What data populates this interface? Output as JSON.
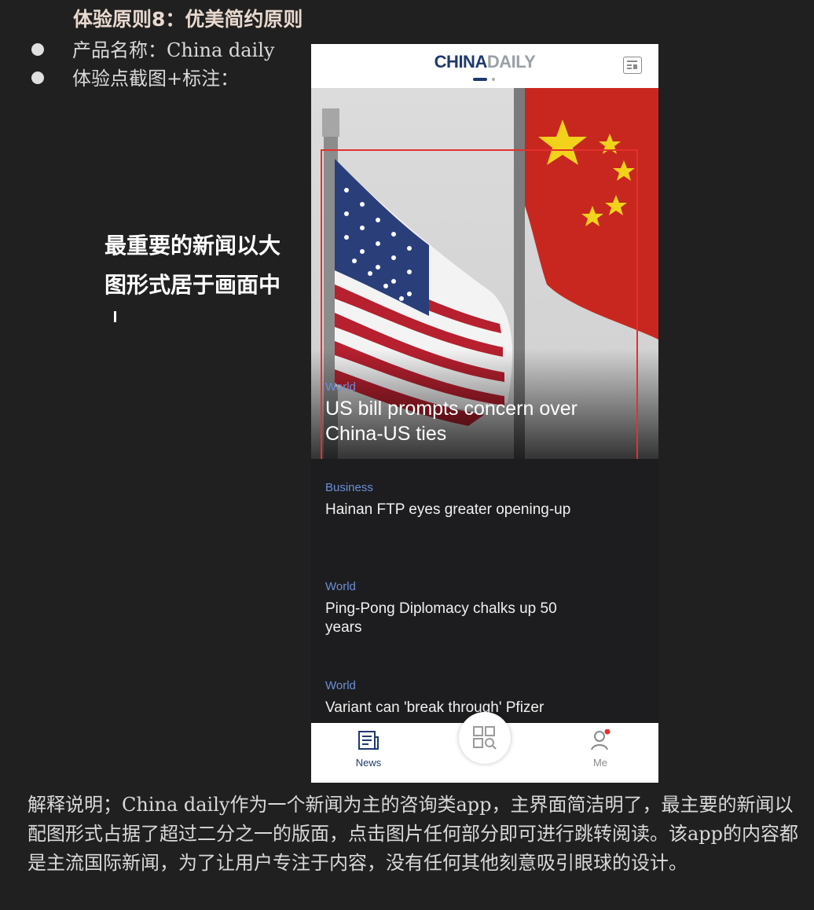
{
  "document": {
    "title": "体验原则8：优美简约原则",
    "bullets": [
      {
        "text": "产品名称：China daily"
      },
      {
        "text": "体验点截图+标注："
      }
    ],
    "annotation": "最重要的新闻以大图形式居于画面中",
    "explanation": "解释说明；China daily作为一个新闻为主的咨询类app，主界面简洁明了，最主要的新闻以配图形式占据了超过二分之一的版面，点击图片任何部分即可进行跳转阅读。该app的内容都是主流国际新闻，为了让用户专注于内容，没有任何其他刻意吸引眼球的设计。"
  },
  "app": {
    "logo": {
      "china": "CHINA",
      "daily": "DAILY"
    },
    "menu_icon": "menu-list-icon",
    "hero": {
      "category": "World",
      "title": "US bill prompts concern over China-US ties"
    },
    "news": [
      {
        "category": "Business",
        "title": "Hainan FTP eyes greater opening-up"
      },
      {
        "category": "World",
        "title": "Ping-Pong Diplomacy chalks up 50 years"
      },
      {
        "category": "World",
        "title": "Variant can 'break through' Pfizer"
      }
    ],
    "tabs": [
      {
        "label": "News",
        "icon": "newspaper-icon"
      },
      {
        "label": "",
        "icon": "discover-grid-icon"
      },
      {
        "label": "Me",
        "icon": "person-icon"
      }
    ],
    "colors": {
      "brand_blue": "#1f3a6e",
      "category_blue": "#6b8fd6",
      "annotation_red": "#e3312d",
      "notification_dot": "#e3312d"
    }
  }
}
